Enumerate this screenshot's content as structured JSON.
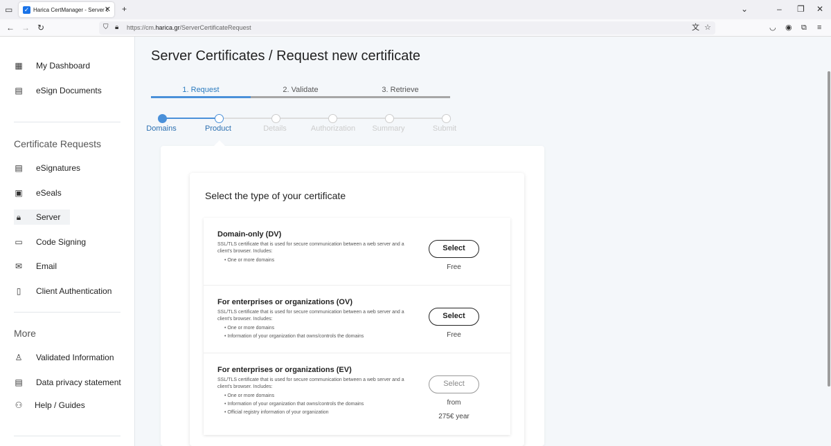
{
  "browser": {
    "tab_title": "Harica CertManager - Server Ce",
    "url_prefix": "https://cm.",
    "url_domain": "harica.gr",
    "url_path": "/ServerCertificateRequest"
  },
  "sidebar": {
    "top_items": [
      {
        "label": "My Dashboard",
        "icon": "dashboard-icon"
      },
      {
        "label": "eSign Documents",
        "icon": "esign-icon"
      }
    ],
    "section_requests": "Certificate Requests",
    "request_items": [
      {
        "label": "eSignatures",
        "icon": "esignatures-icon"
      },
      {
        "label": "eSeals",
        "icon": "eseals-icon"
      },
      {
        "label": "Server",
        "icon": "lock-icon",
        "active": true
      },
      {
        "label": "Code Signing",
        "icon": "code-icon"
      },
      {
        "label": "Email",
        "icon": "email-icon"
      },
      {
        "label": "Client Authentication",
        "icon": "badge-icon"
      }
    ],
    "section_more": "More",
    "more_items": [
      {
        "label": "Validated Information",
        "icon": "validated-icon"
      },
      {
        "label": "Data privacy statement",
        "icon": "privacy-icon"
      },
      {
        "label": "Help / Guides",
        "icon": "help-icon"
      }
    ]
  },
  "page": {
    "title": "Server Certificates / Request new certificate",
    "steps": [
      "1. Request",
      "2. Validate",
      "3. Retrieve"
    ],
    "progress": [
      "Domains",
      "Product",
      "Details",
      "Authorization",
      "Summary",
      "Submit"
    ],
    "card_title": "Select the type of your certificate",
    "options": [
      {
        "title": "Domain-only (DV)",
        "desc": "SSL/TLS certificate that is used for secure communication between a web server and a client's browser. Includes:",
        "bullets": [
          "• One or more domains"
        ],
        "button": "Select",
        "price": "Free",
        "price2": ""
      },
      {
        "title": "For enterprises or organizations (OV)",
        "desc": "SSL/TLS certificate that is used for secure communication between a web server and a client's browser. Includes:",
        "bullets": [
          "• One or more domains",
          "• Information of your organization that owns/controls the domains"
        ],
        "button": "Select",
        "price": "Free",
        "price2": ""
      },
      {
        "title": "For enterprises or organizations (EV)",
        "desc": "SSL/TLS certificate that is used for secure communication between a web server and a client's browser. Includes:",
        "bullets": [
          "• One or more domains",
          "• Information of your organization that owns/controls the domains",
          "• Official registry information of your organization"
        ],
        "button": "Select",
        "price": "from",
        "price2": "275€ year"
      }
    ]
  },
  "colors": {
    "accent": "#4a90d9",
    "step_active": "#2b7bbf"
  }
}
